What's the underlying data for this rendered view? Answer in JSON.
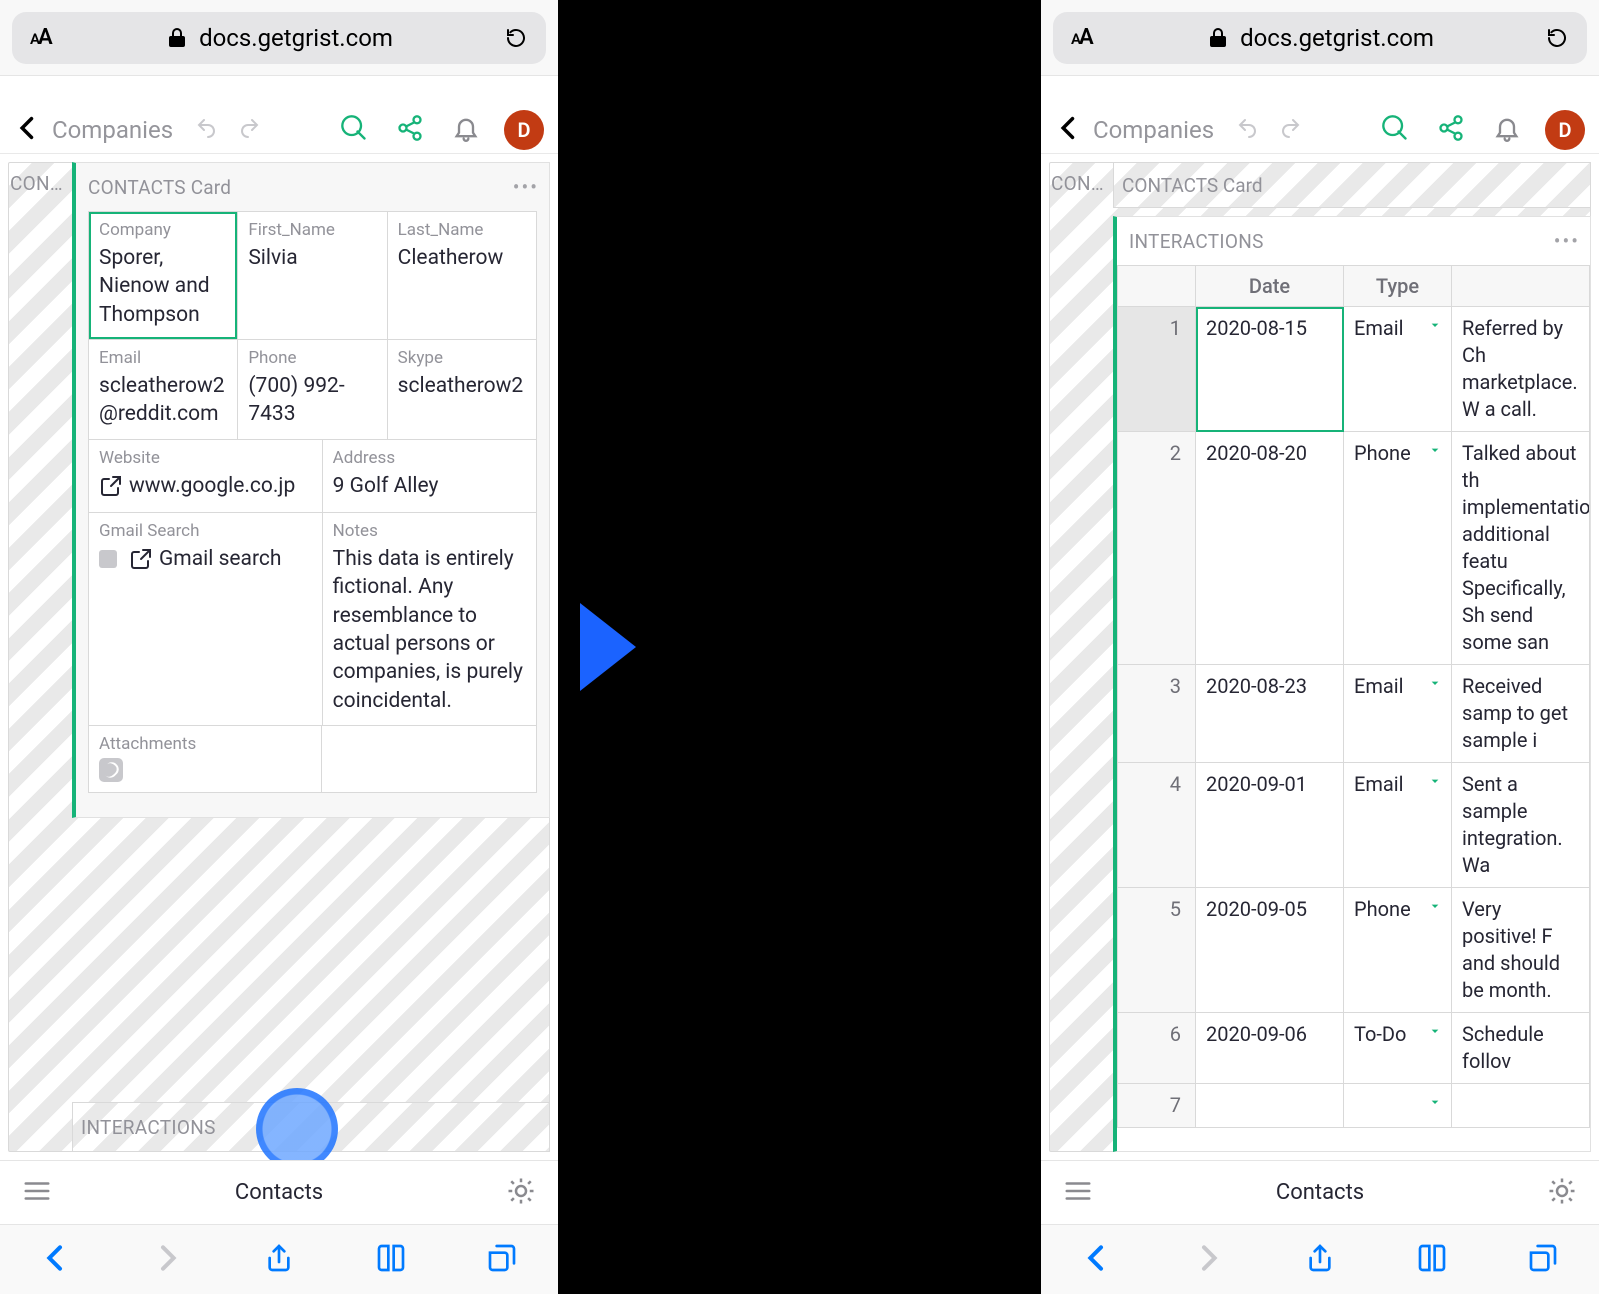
{
  "browser_url": "docs.getgrist.com",
  "app": {
    "back_label": "Companies",
    "avatar_letter": "D"
  },
  "left": {
    "peeked_tab": "CON…",
    "card_title": "CONTACTS Card",
    "fields": {
      "company": {
        "label": "Company",
        "value": "Sporer, Nienow and Thompson"
      },
      "first_name": {
        "label": "First_Name",
        "value": "Silvia"
      },
      "last_name": {
        "label": "Last_Name",
        "value": "Cleatherow"
      },
      "email": {
        "label": "Email",
        "value": "scleatherow2@reddit.com"
      },
      "phone": {
        "label": "Phone",
        "value": "(700) 992-7433"
      },
      "skype": {
        "label": "Skype",
        "value": "scleatherow2"
      },
      "website": {
        "label": "Website",
        "value": "www.google.co.jp"
      },
      "address": {
        "label": "Address",
        "value": "9 Golf Alley"
      },
      "gmail_search": {
        "label": "Gmail Search",
        "value": "Gmail search"
      },
      "notes": {
        "label": "Notes",
        "value": "This data is entirely fictional. Any resemblance to actual persons or companies, is purely coincidental."
      },
      "attachments": {
        "label": "Attachments"
      }
    },
    "interactions_collapsed_label": "INTERACTIONS"
  },
  "right": {
    "peeked_tab": "CON…",
    "card_title_collapsed": "CONTACTS Card",
    "interactions_title": "INTERACTIONS",
    "columns": {
      "date": "Date",
      "type": "Type"
    },
    "rows": [
      {
        "n": 1,
        "date": "2020-08-15",
        "type": "Email",
        "notes": "Referred by Ch marketplace. W a call."
      },
      {
        "n": 2,
        "date": "2020-08-20",
        "type": "Phone",
        "notes": "Talked about th implementation additional featu Specifically, Sh send some san"
      },
      {
        "n": 3,
        "date": "2020-08-23",
        "type": "Email",
        "notes": "Received samp to get sample i"
      },
      {
        "n": 4,
        "date": "2020-09-01",
        "type": "Email",
        "notes": "Sent a sample integration. Wa"
      },
      {
        "n": 5,
        "date": "2020-09-05",
        "type": "Phone",
        "notes": "Very positive! F and should be month."
      },
      {
        "n": 6,
        "date": "2020-09-06",
        "type": "To-Do",
        "notes": "Schedule follov"
      },
      {
        "n": 7,
        "date": "",
        "type": "",
        "notes": ""
      }
    ]
  },
  "bottom": {
    "page_label": "Contacts"
  }
}
